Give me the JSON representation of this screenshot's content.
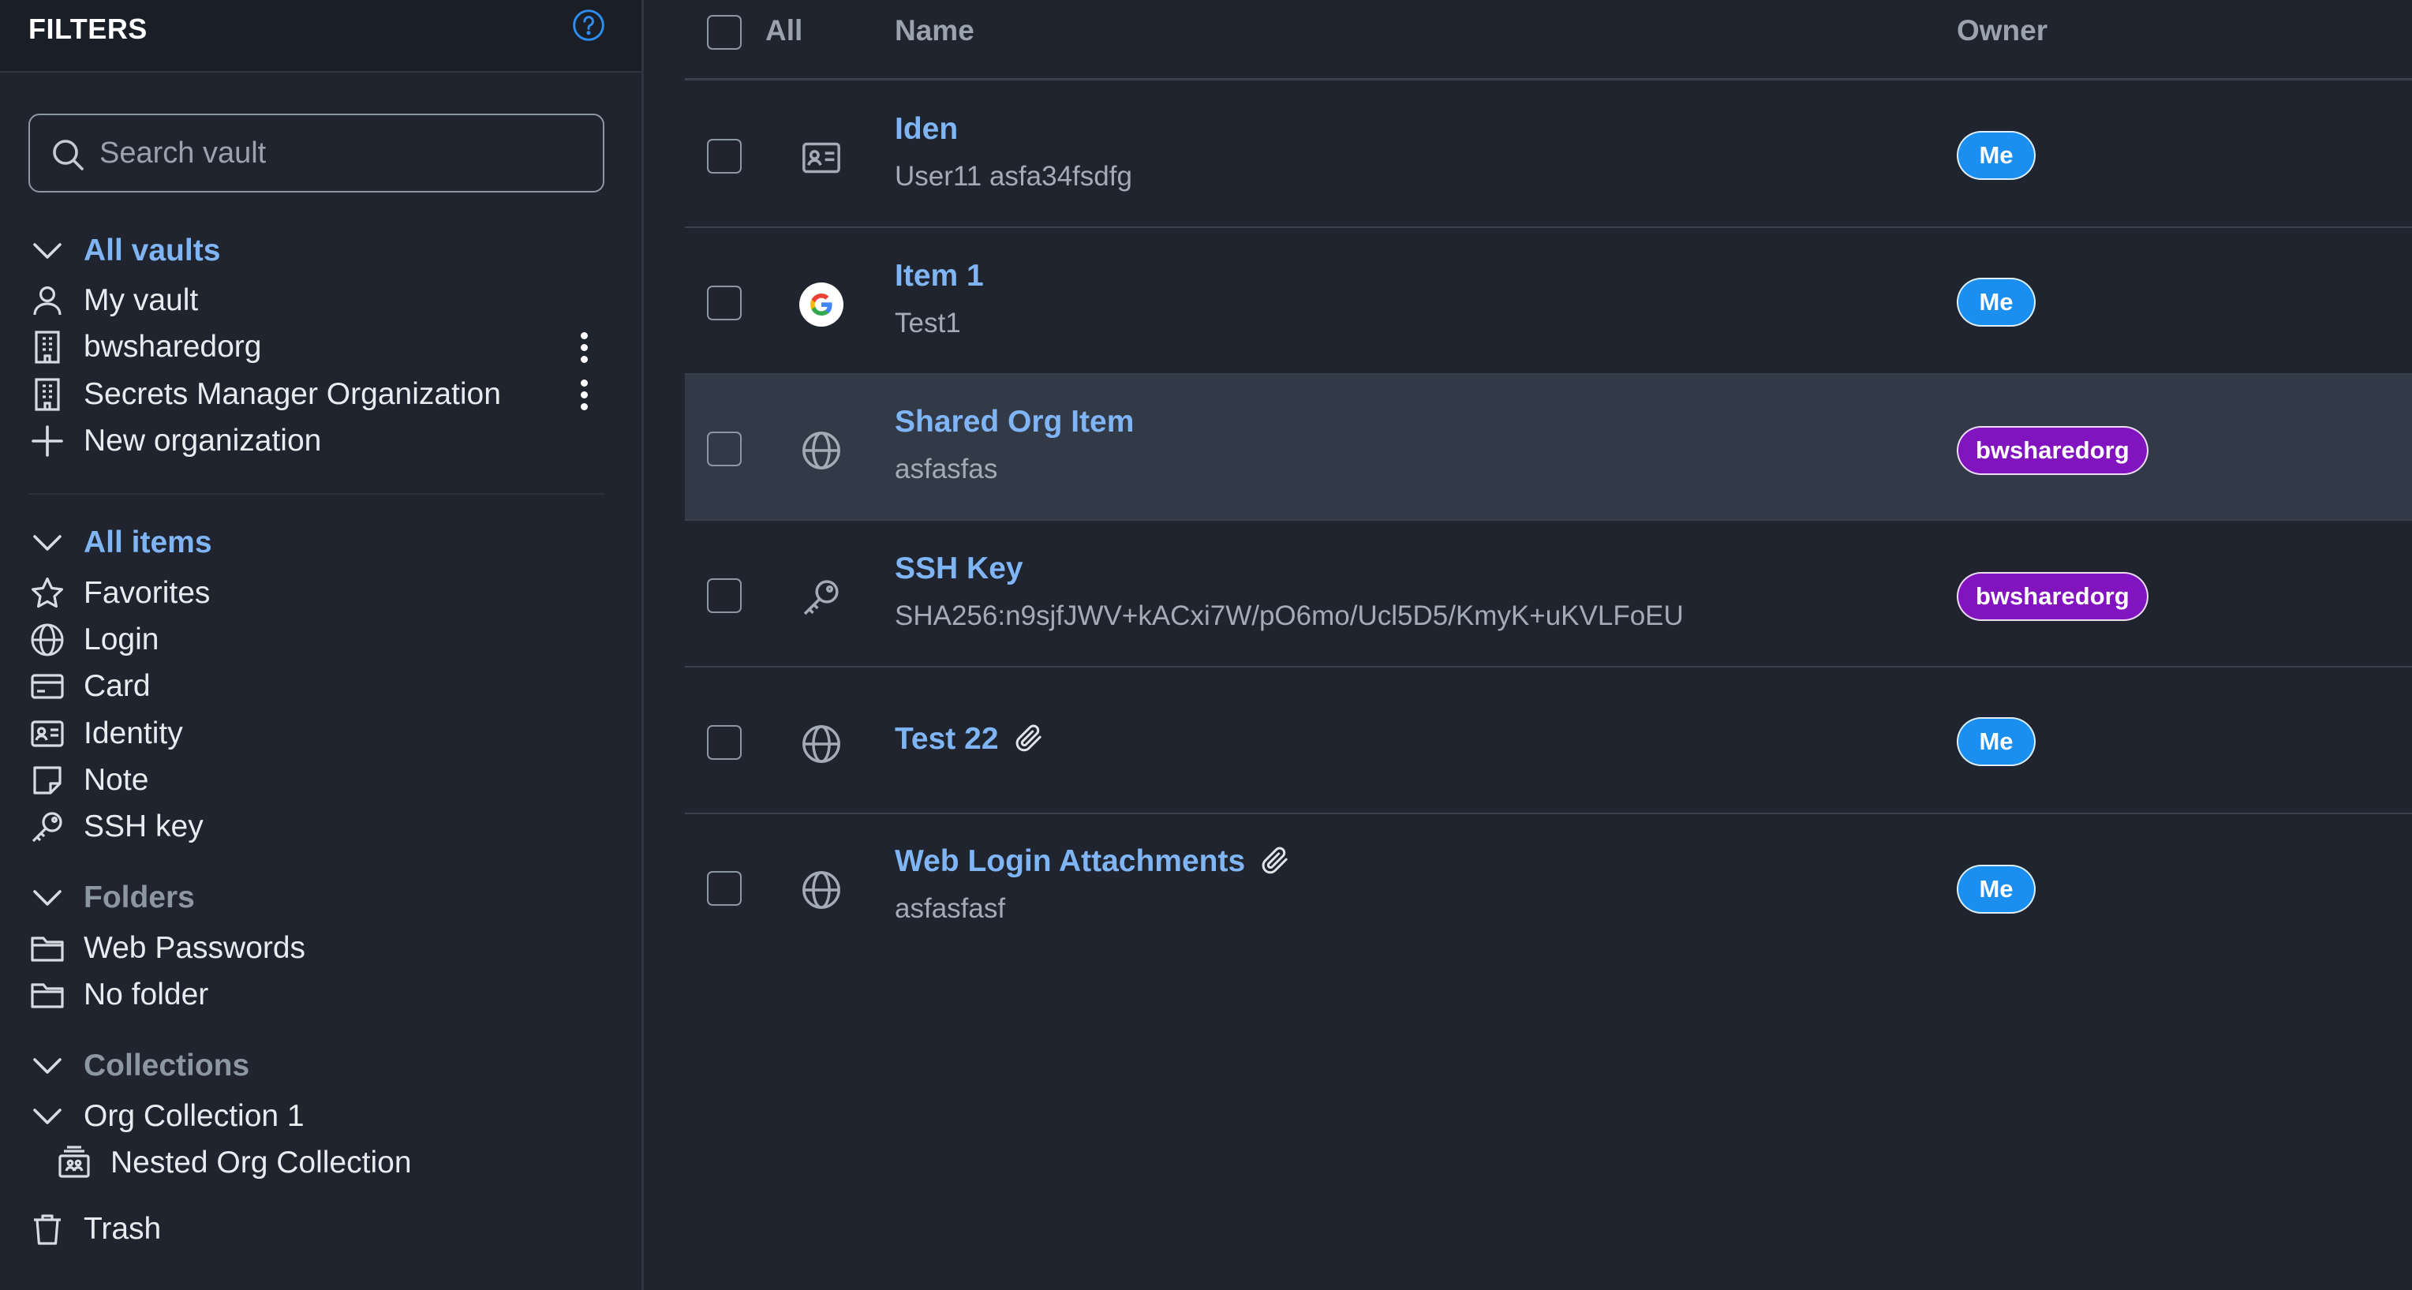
{
  "sidebar": {
    "title": "FILTERS",
    "search_placeholder": "Search vault",
    "vaults": {
      "header": "All vaults",
      "items": [
        {
          "label": "My vault"
        },
        {
          "label": "bwsharedorg"
        },
        {
          "label": "Secrets Manager Organization"
        },
        {
          "label": "New organization"
        }
      ]
    },
    "types": {
      "header": "All items",
      "items": [
        {
          "label": "Favorites"
        },
        {
          "label": "Login"
        },
        {
          "label": "Card"
        },
        {
          "label": "Identity"
        },
        {
          "label": "Note"
        },
        {
          "label": "SSH key"
        }
      ]
    },
    "folders": {
      "header": "Folders",
      "items": [
        {
          "label": "Web Passwords"
        },
        {
          "label": "No folder"
        }
      ]
    },
    "collections": {
      "header": "Collections",
      "items": [
        {
          "label": "Org Collection 1"
        },
        {
          "label": "Nested Org Collection"
        }
      ]
    },
    "trash": "Trash"
  },
  "table": {
    "headers": {
      "all": "All",
      "name": "Name",
      "owner": "Owner"
    },
    "rows": [
      {
        "name": "Iden",
        "subtitle": "User11 asfa34fsdfg",
        "owner": "Me",
        "icon": "identity-card-icon"
      },
      {
        "name": "Item 1",
        "subtitle": "Test1",
        "owner": "Me",
        "icon": "google-logo-icon"
      },
      {
        "name": "Shared Org Item",
        "subtitle": "asfasfas",
        "owner": "bwsharedorg",
        "icon": "globe-icon"
      },
      {
        "name": "SSH Key",
        "subtitle": "SHA256:n9sjfJWV+kACxi7W/pO6mo/Ucl5D5/KmyK+uKVLFoEU",
        "owner": "bwsharedorg",
        "icon": "key-icon"
      },
      {
        "name": "Test 22",
        "subtitle": "",
        "owner": "Me",
        "icon": "globe-icon",
        "attachment": true
      },
      {
        "name": "Web Login Attachments",
        "subtitle": "asfasfasf",
        "owner": "Me",
        "icon": "globe-icon",
        "attachment": true
      }
    ]
  },
  "colors": {
    "background": "#1f242e",
    "link": "#7fb5f5",
    "badge_me": "#1a8ff0",
    "badge_org": "#8214c0",
    "row_highlight": "#323a47"
  }
}
